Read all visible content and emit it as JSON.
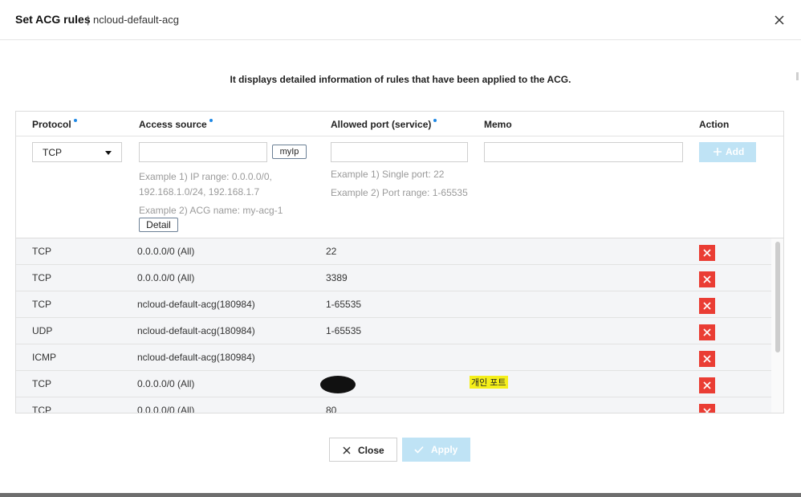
{
  "dialog": {
    "title": "Set ACG rules",
    "separator": "|",
    "subtitle": "ncloud-default-acg",
    "description": "It displays detailed information of rules that have been applied to the ACG."
  },
  "columns": {
    "protocol": "Protocol",
    "access_source": "Access source",
    "allowed_port": "Allowed port (service)",
    "memo": "Memo",
    "action": "Action"
  },
  "form": {
    "protocol_value": "TCP",
    "myip_label": "myIp",
    "access_example_1a": "Example 1) IP range: 0.0.0.0/0,",
    "access_example_1b": "192.168.1.0/24, 192.168.1.7",
    "access_example_2": "Example 2) ACG name: my-acg-1",
    "detail_label": "Detail",
    "port_example_1": "Example 1) Single port: 22",
    "port_example_2": "Example 2) Port range: 1-65535",
    "add_label": "Add"
  },
  "rules": [
    {
      "protocol": "TCP",
      "source": "0.0.0.0/0 (All)",
      "port": "22",
      "memo": ""
    },
    {
      "protocol": "TCP",
      "source": "0.0.0.0/0 (All)",
      "port": "3389",
      "memo": ""
    },
    {
      "protocol": "TCP",
      "source": "ncloud-default-acg(180984)",
      "port": "1-65535",
      "memo": ""
    },
    {
      "protocol": "UDP",
      "source": "ncloud-default-acg(180984)",
      "port": "1-65535",
      "memo": ""
    },
    {
      "protocol": "ICMP",
      "source": "ncloud-default-acg(180984)",
      "port": "",
      "memo": ""
    },
    {
      "protocol": "TCP",
      "source": "0.0.0.0/0 (All)",
      "port": "",
      "memo": "개인 포트"
    },
    {
      "protocol": "TCP",
      "source": "0.0.0.0/0 (All)",
      "port": "80",
      "memo": ""
    }
  ],
  "footer": {
    "close_label": "Close",
    "apply_label": "Apply"
  },
  "colors": {
    "accent": "#1e88e5",
    "delete": "#ea3d34",
    "disabled_button": "#bfe3f5",
    "memo_highlight": "#f5ef1a"
  }
}
